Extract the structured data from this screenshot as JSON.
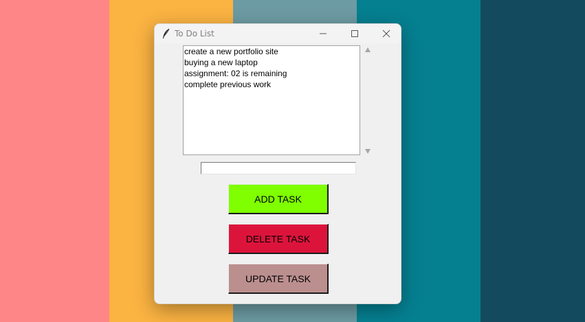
{
  "colors": {
    "stripes": [
      "#ff8686",
      "#fbb342",
      "#6d9ba3",
      "#058091",
      "#134a5e"
    ],
    "add_button": "#7fff00",
    "delete_button": "#dc143c",
    "update_button": "#bc8f8f"
  },
  "window": {
    "title": "To Do List",
    "icon": "feather-icon"
  },
  "task_list": {
    "items": [
      "create a new portfolio site",
      "buying a new laptop",
      "assignment: 02 is remaining",
      "complete previous work"
    ]
  },
  "task_entry": {
    "value": ""
  },
  "buttons": {
    "add": "ADD TASK",
    "delete": "DELETE TASK",
    "update": "UPDATE TASK"
  }
}
